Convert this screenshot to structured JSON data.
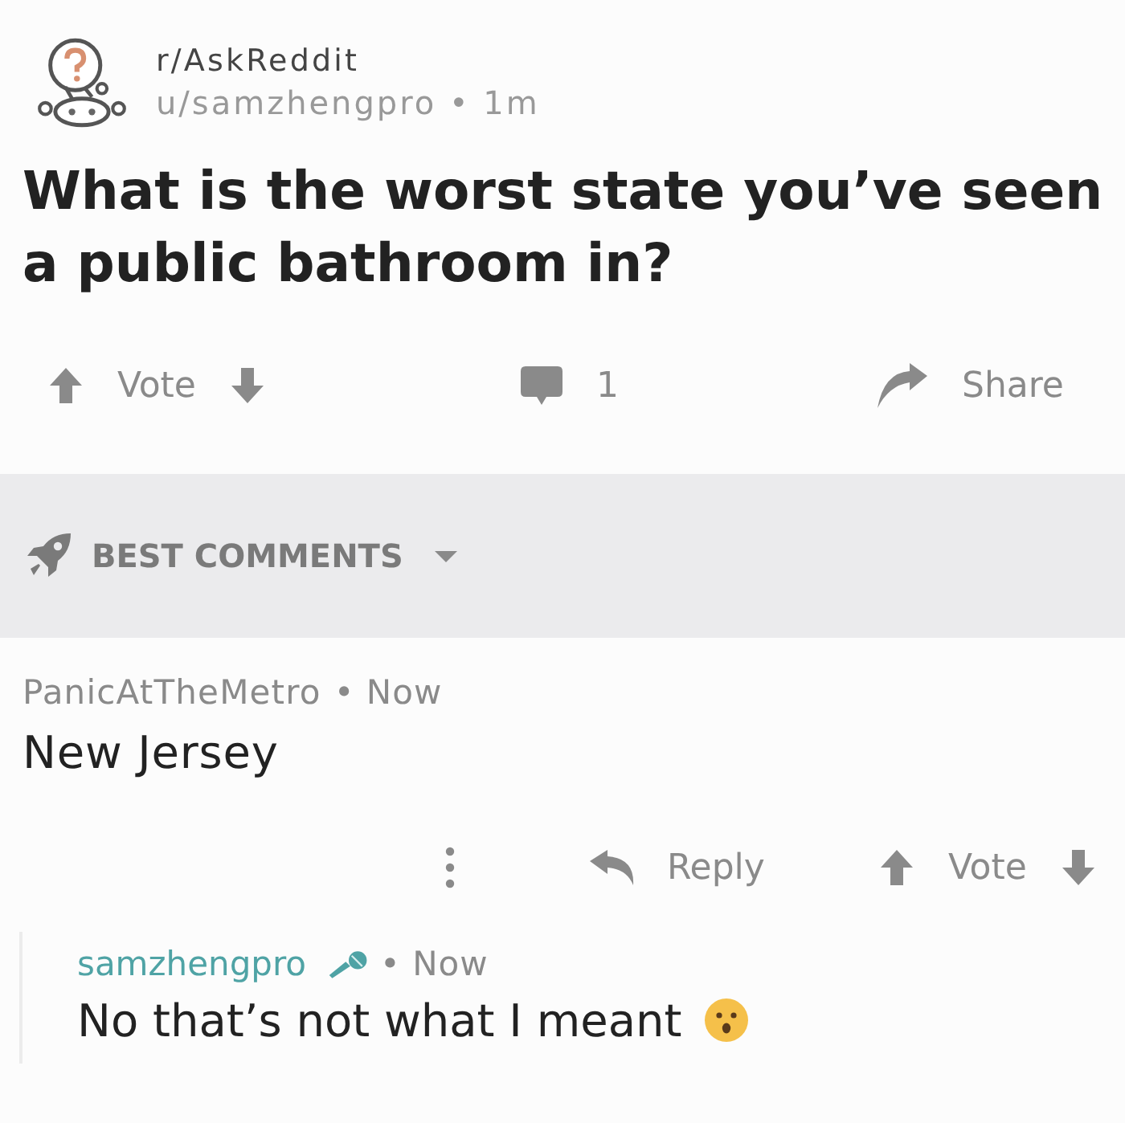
{
  "post": {
    "subreddit": "r/AskReddit",
    "byline": "u/samzhengpro • 1m",
    "title": "What is the worst state you’ve seen a public bathroom in?",
    "vote_label": "Vote",
    "comment_count": "1",
    "share_label": "Share"
  },
  "sort": {
    "label": "BEST COMMENTS"
  },
  "comments": [
    {
      "author": "PanicAtTheMetro",
      "op": false,
      "time": "• Now",
      "body": "New Jersey",
      "has_emoji": false,
      "reply_label": "Reply",
      "vote_label": "Vote",
      "replies": [
        {
          "author": "samzhengpro",
          "op": true,
          "time": "• Now",
          "body": "No that’s not what I meant",
          "has_emoji": true
        }
      ]
    }
  ]
}
